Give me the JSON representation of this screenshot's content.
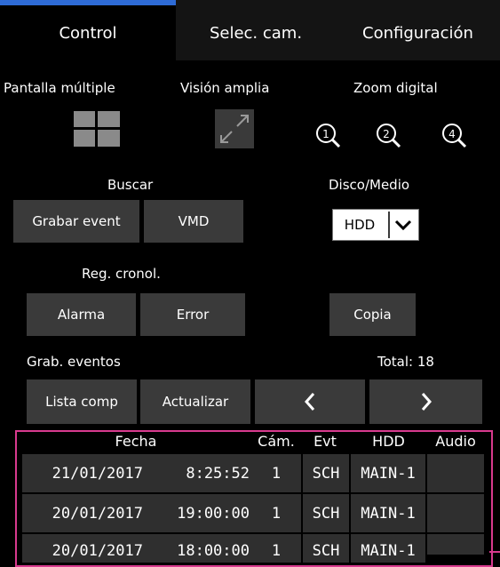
{
  "tabs": [
    {
      "label": "Control"
    },
    {
      "label": "Selec. cam."
    },
    {
      "label": "Configuración"
    }
  ],
  "views": {
    "multi_label": "Pantalla múltiple",
    "wide_label": "Visión amplia",
    "zoom_label": "Zoom digital",
    "zoom_levels": [
      "1",
      "2",
      "4"
    ]
  },
  "search": {
    "label": "Buscar",
    "event_button": "Grabar event",
    "vmd_button": "VMD"
  },
  "disk": {
    "label": "Disco/Medio",
    "selected": "HDD"
  },
  "timeline": {
    "label": "Reg. cronol.",
    "alarm_button": "Alarma",
    "error_button": "Error",
    "copy_button": "Copia"
  },
  "events": {
    "label": "Grab. eventos",
    "total": "Total: 18",
    "list_button": "Lista comp",
    "refresh_button": "Actualizar"
  },
  "table": {
    "headers": [
      "Fecha",
      "Cám.",
      "Evt",
      "HDD",
      "Audio"
    ],
    "rows": [
      {
        "date": "21/01/2017",
        "time": "8:25:52",
        "cam": "1",
        "evt": "SCH",
        "hdd": "MAIN-1",
        "audio": ""
      },
      {
        "date": "20/01/2017",
        "time": "19:00:00",
        "cam": "1",
        "evt": "SCH",
        "hdd": "MAIN-1",
        "audio": ""
      },
      {
        "date": "20/01/2017",
        "time": "18:00:00",
        "cam": "1",
        "evt": "SCH",
        "hdd": "MAIN-1",
        "audio": ""
      }
    ]
  },
  "colors": {
    "accent": "#2e6bd6",
    "highlight_frame": "#d83a8e",
    "button": "#3a3a3a"
  }
}
